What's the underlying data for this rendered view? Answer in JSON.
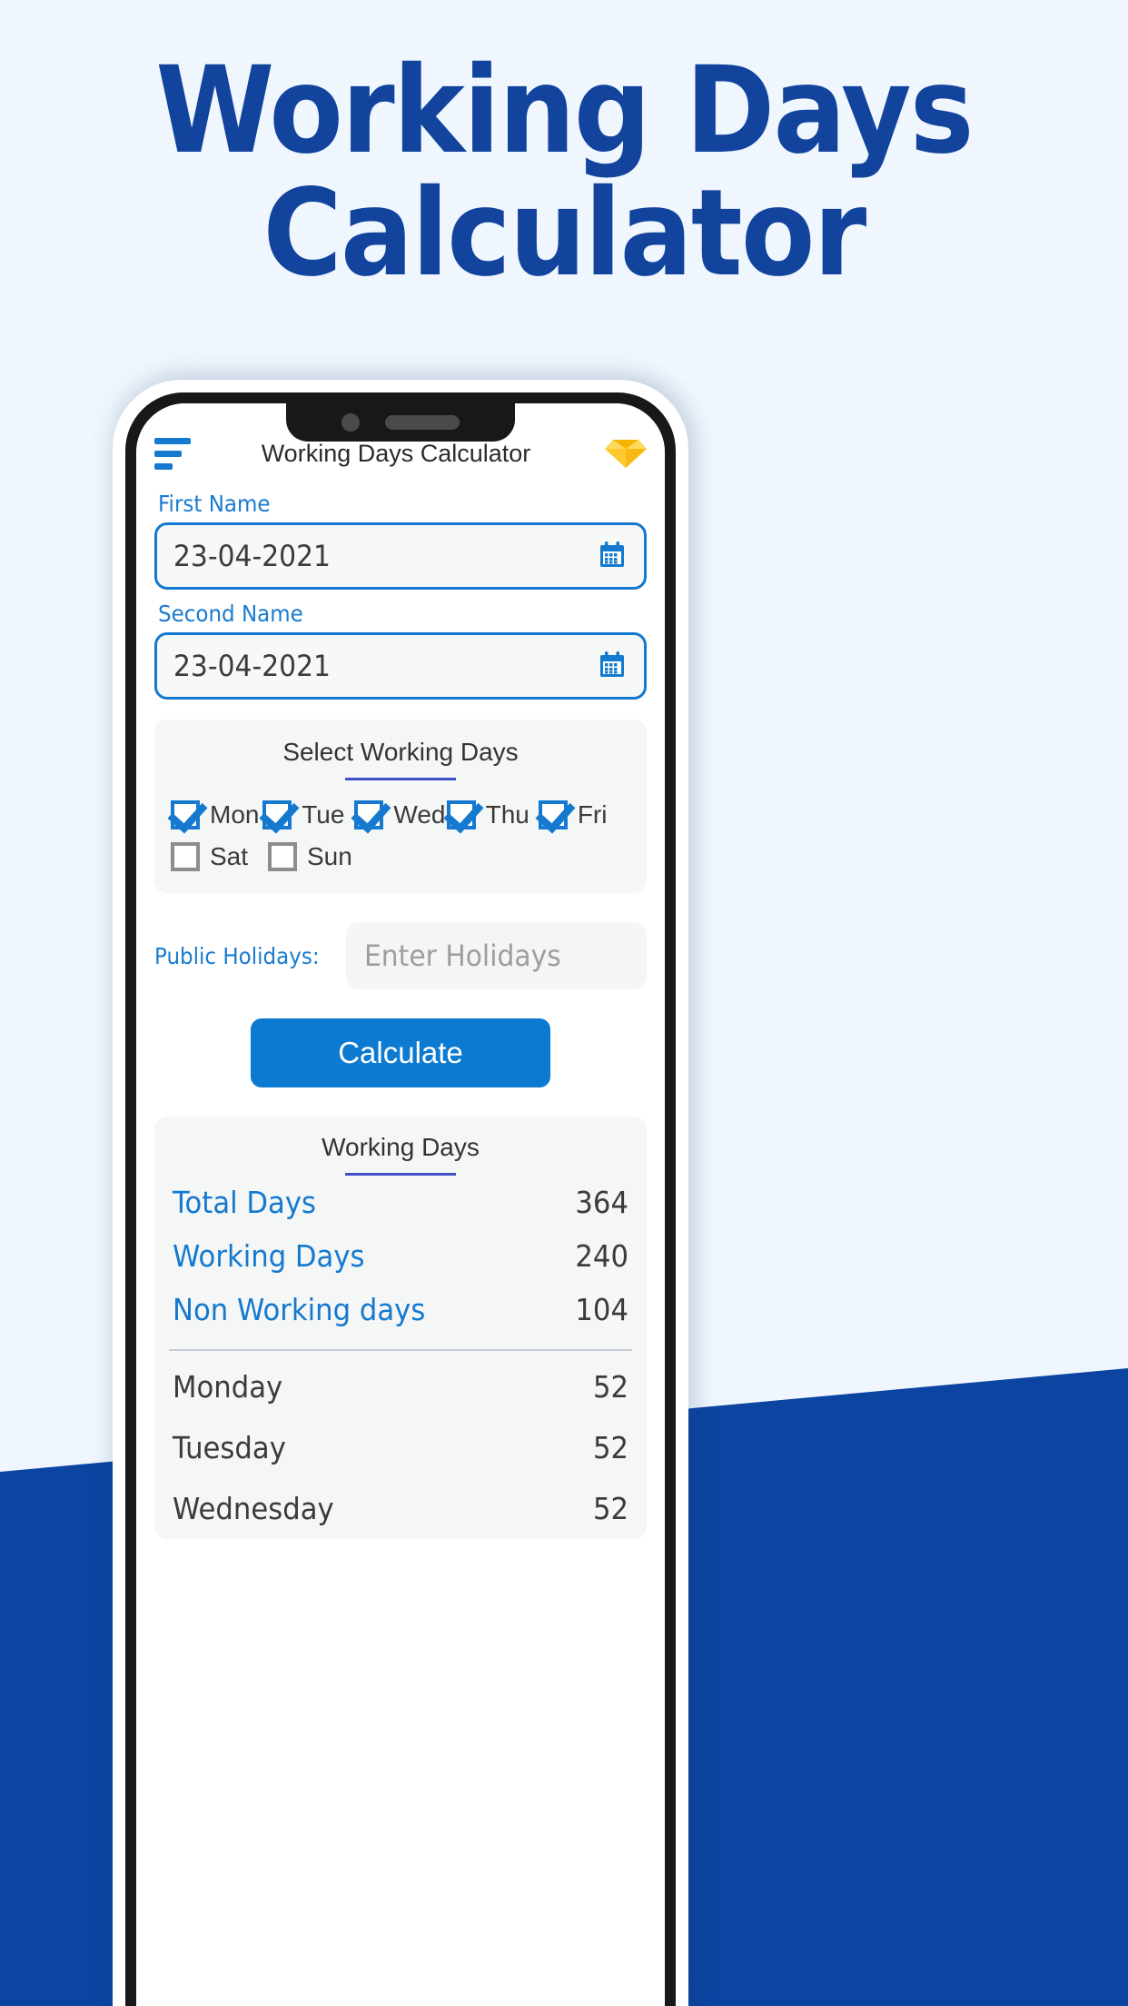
{
  "hero": {
    "line1": "Working Days",
    "line2": "Calculator",
    "color": "#12449e"
  },
  "background": {
    "page_color": "#eff6fd",
    "shape_color": "#0c44a1"
  },
  "phone": {
    "appbar": {
      "menu_icon": "hamburger-icon",
      "title": "Working Days Calculator",
      "premium_icon": "diamond-icon",
      "premium_color": "#fcc524"
    },
    "first_date": {
      "label": "First Name",
      "value": "23-04-2021",
      "icon": "calendar-icon"
    },
    "second_date": {
      "label": "Second Name",
      "value": "23-04-2021",
      "icon": "calendar-icon"
    },
    "working_days_card": {
      "title": "Select Working Days",
      "days": [
        {
          "label": "Mon",
          "checked": true
        },
        {
          "label": "Tue",
          "checked": true
        },
        {
          "label": "Wed",
          "checked": true
        },
        {
          "label": "Thu",
          "checked": true
        },
        {
          "label": "Fri",
          "checked": true
        },
        {
          "label": "Sat",
          "checked": false
        },
        {
          "label": "Sun",
          "checked": false
        }
      ]
    },
    "holidays": {
      "label": "Public Holidays:",
      "value": "",
      "placeholder": "Enter Holidays"
    },
    "calculate_button": {
      "label": "Calculate",
      "color": "#0c7ad0"
    },
    "results": {
      "title": "Working Days",
      "summary": [
        {
          "label": "Total Days",
          "value": "364"
        },
        {
          "label": "Working Days",
          "value": "240"
        },
        {
          "label": "Non Working days",
          "value": "104"
        }
      ],
      "weekdays": [
        {
          "label": "Monday",
          "value": "52"
        },
        {
          "label": "Tuesday",
          "value": "52"
        },
        {
          "label": "Wednesday",
          "value": "52"
        }
      ]
    }
  }
}
